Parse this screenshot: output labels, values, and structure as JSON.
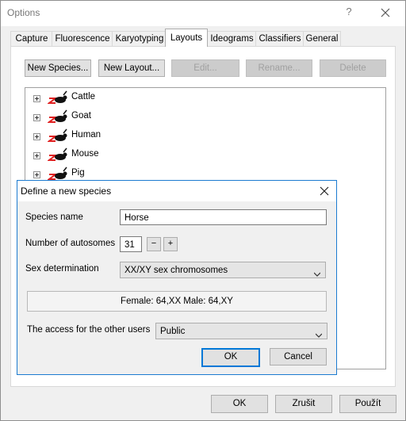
{
  "window": {
    "title": "Options",
    "help_glyph": "?",
    "close_icon": "close-icon"
  },
  "tabs": [
    {
      "label": "Capture"
    },
    {
      "label": "Fluorescence"
    },
    {
      "label": "Karyotyping"
    },
    {
      "label": "Layouts",
      "active": true
    },
    {
      "label": "Ideograms"
    },
    {
      "label": "Classifiers"
    },
    {
      "label": "General"
    }
  ],
  "toolbar": {
    "new_species": "New Species...",
    "new_layout": "New Layout...",
    "edit": "Edit...",
    "rename": "Rename...",
    "delete": "Delete"
  },
  "tree": {
    "items": [
      {
        "label": "Cattle"
      },
      {
        "label": "Goat"
      },
      {
        "label": "Human"
      },
      {
        "label": "Mouse"
      },
      {
        "label": "Pig"
      }
    ]
  },
  "footer": {
    "ok": "OK",
    "cancel": "Zrušit",
    "apply": "Použít"
  },
  "dialog": {
    "title": "Define a new species",
    "species_name_label": "Species name",
    "species_name_value": "Horse",
    "autosomes_label": "Number of autosomes",
    "autosomes_value": "31",
    "minus": "−",
    "plus": "+",
    "sex_label": "Sex determination",
    "sex_value": "XX/XY sex chromosomes",
    "karyotype_info": "Female: 64,XX   Male: 64,XY",
    "access_label": "The access for the other users",
    "access_value": "Public",
    "ok": "OK",
    "cancel": "Cancel"
  }
}
